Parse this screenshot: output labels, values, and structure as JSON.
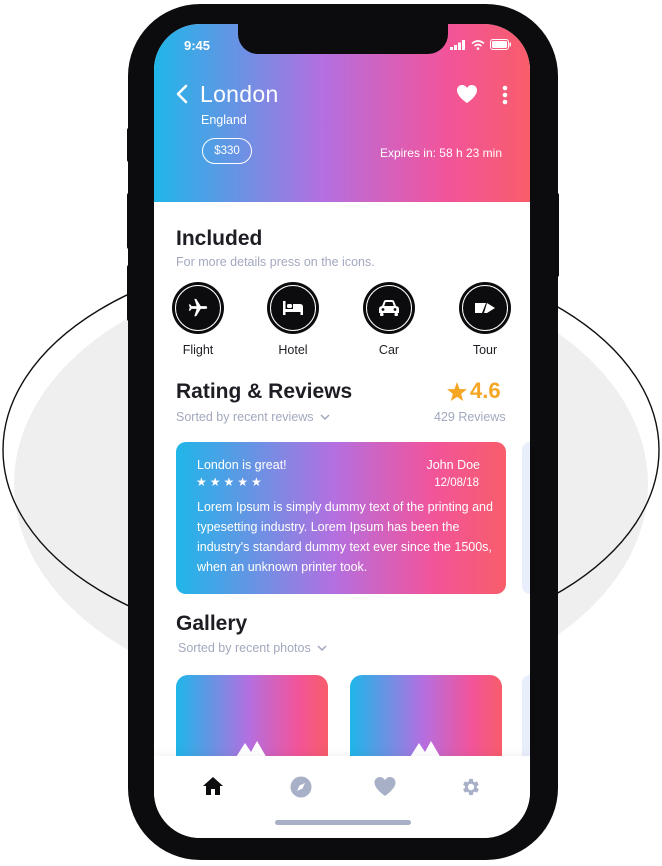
{
  "status_bar": {
    "time": "9:45"
  },
  "header": {
    "city": "London",
    "country": "England",
    "price": "$330",
    "expires": "Expires in: 58 h 23 min",
    "icons": [
      "back-chevron-icon",
      "heart-icon",
      "more-vertical-icon"
    ]
  },
  "included": {
    "title": "Included",
    "subtitle": "For more details press on the icons.",
    "items": [
      {
        "label": "Flight",
        "icon": "airplane-icon"
      },
      {
        "label": "Hotel",
        "icon": "bed-icon"
      },
      {
        "label": "Car",
        "icon": "car-icon"
      },
      {
        "label": "Tour",
        "icon": "ticket-icon"
      }
    ]
  },
  "ratings": {
    "title": "Rating & Reviews",
    "sort_label": "Sorted by recent reviews",
    "score": "4.6",
    "count": "429 Reviews"
  },
  "review": {
    "title": "London is great!",
    "author": "John Doe",
    "date": "12/08/18",
    "stars": "★★★★★",
    "text": "Lorem Ipsum is simply dummy text of the printing and typesetting industry. Lorem Ipsum has been the industry's standard dummy text ever since the 1500s, when an unknown printer took."
  },
  "gallery": {
    "title": "Gallery",
    "sort_label": "Sorted by recent photos"
  },
  "tabbar": {
    "items": [
      "home-icon",
      "compass-icon",
      "heart-icon",
      "gear-icon"
    ],
    "active": "home-icon"
  },
  "colors": {
    "gradient_start": "#1fb6e8",
    "gradient_mid": "#b46fe0",
    "gradient_end": "#f85d6a",
    "rating_star": "#f5a623",
    "muted_text": "#a3a8be",
    "inactive_tab": "#a8b0c8"
  }
}
